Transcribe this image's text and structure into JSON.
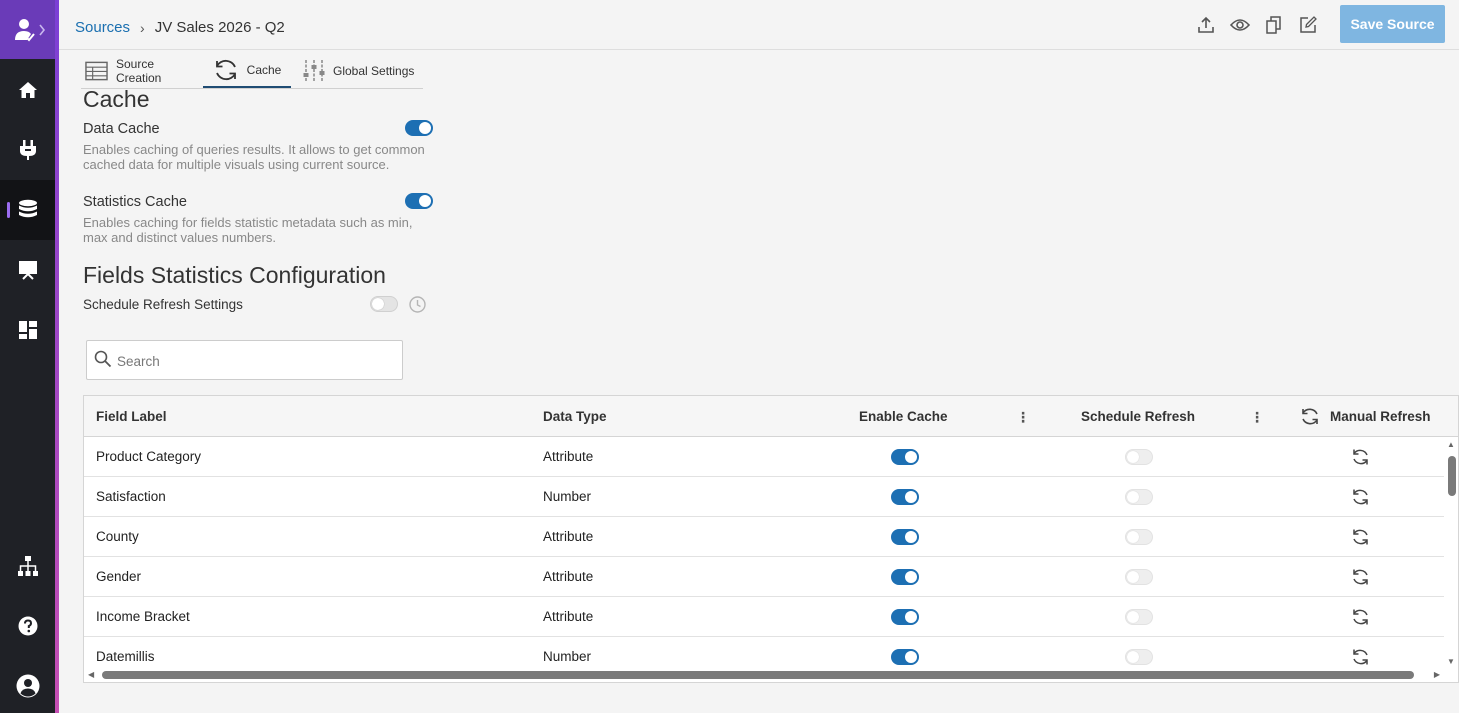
{
  "nav": {
    "items": [
      {
        "name": "user-check-icon"
      },
      {
        "name": "home-icon"
      },
      {
        "name": "plug-icon"
      },
      {
        "name": "database-icon",
        "active": true
      },
      {
        "name": "presentation-icon"
      },
      {
        "name": "dashboard-icon"
      },
      {
        "name": "sitemap-icon"
      },
      {
        "name": "help-icon"
      },
      {
        "name": "account-icon"
      }
    ]
  },
  "header": {
    "breadcrumb_root": "Sources",
    "breadcrumb_separator": "›",
    "breadcrumb_current": "JV Sales 2026 - Q2",
    "icons": [
      "upload-icon",
      "eye-icon",
      "copy-icon",
      "edit-icon"
    ],
    "save_label": "Save Source"
  },
  "tabs": [
    {
      "label": "Source Creation",
      "icon": "table-icon",
      "active": false
    },
    {
      "label": "Cache",
      "icon": "refresh-icon",
      "active": true
    },
    {
      "label": "Global Settings",
      "icon": "sliders-icon",
      "active": false
    }
  ],
  "cache": {
    "title": "Cache",
    "data_cache": {
      "label": "Data Cache",
      "description": "Enables caching of queries results. It allows to get common cached data for multiple visuals using current source.",
      "enabled": true
    },
    "statistics_cache": {
      "label": "Statistics Cache",
      "description": "Enables caching for fields statistic metadata such as min, max and distinct values numbers.",
      "enabled": true
    }
  },
  "fields_stats": {
    "title": "Fields Statistics Configuration",
    "schedule_label": "Schedule Refresh Settings",
    "schedule_enabled": false
  },
  "search": {
    "placeholder": "Search",
    "value": ""
  },
  "table": {
    "columns": {
      "field_label": "Field Label",
      "data_type": "Data Type",
      "enable_cache": "Enable Cache",
      "schedule_refresh": "Schedule Refresh",
      "manual_refresh": "Manual Refresh"
    },
    "rows": [
      {
        "label": "Product Category",
        "type": "Attribute",
        "cache": true,
        "schedule": false
      },
      {
        "label": "Satisfaction",
        "type": "Number",
        "cache": true,
        "schedule": false
      },
      {
        "label": "County",
        "type": "Attribute",
        "cache": true,
        "schedule": false
      },
      {
        "label": "Gender",
        "type": "Attribute",
        "cache": true,
        "schedule": false
      },
      {
        "label": "Income Bracket",
        "type": "Attribute",
        "cache": true,
        "schedule": false
      },
      {
        "label": "Datemillis",
        "type": "Number",
        "cache": true,
        "schedule": false
      }
    ]
  }
}
